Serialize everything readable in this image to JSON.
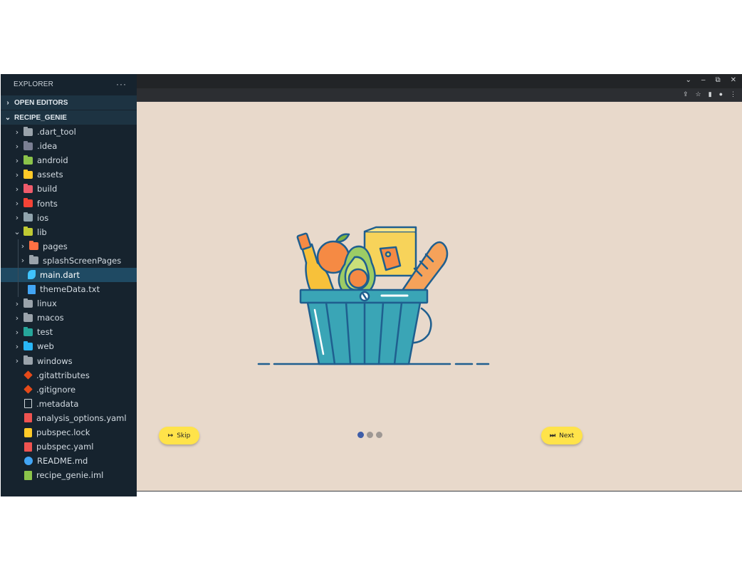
{
  "explorer": {
    "title": "EXPLORER",
    "more": "···",
    "sections": {
      "open_editors": "OPEN EDITORS",
      "project": "RECIPE_GENIE"
    },
    "items": [
      {
        "label": ".dart_tool",
        "color": "#9aa3ab"
      },
      {
        "label": ".idea",
        "color": "#7a7f93"
      },
      {
        "label": "android",
        "color": "#8bc34a"
      },
      {
        "label": "assets",
        "color": "#ffca28"
      },
      {
        "label": "build",
        "color": "#ef5b6b"
      },
      {
        "label": "fonts",
        "color": "#f44336"
      },
      {
        "label": "ios",
        "color": "#90a4ae"
      },
      {
        "label": "lib",
        "color": "#c0ca33"
      },
      {
        "label": "pages",
        "color": "#ff7043"
      },
      {
        "label": "splashScreenPages",
        "color": "#9aa3ab"
      },
      {
        "label": "main.dart",
        "color": "#40c4ff"
      },
      {
        "label": "themeData.txt",
        "color": "#42a5f5"
      },
      {
        "label": "linux",
        "color": "#9aa3ab"
      },
      {
        "label": "macos",
        "color": "#9aa3ab"
      },
      {
        "label": "test",
        "color": "#26a69a"
      },
      {
        "label": "web",
        "color": "#29b6f6"
      },
      {
        "label": "windows",
        "color": "#9aa3ab"
      },
      {
        "label": ".gitattributes",
        "color": "#e64a19"
      },
      {
        "label": ".gitignore",
        "color": "#e64a19"
      },
      {
        "label": ".metadata",
        "color": "#cfd8dc"
      },
      {
        "label": "analysis_options.yaml",
        "color": "#ef5350"
      },
      {
        "label": "pubspec.lock",
        "color": "#ffca28"
      },
      {
        "label": "pubspec.yaml",
        "color": "#ef5350"
      },
      {
        "label": "README.md",
        "color": "#42a5f5"
      },
      {
        "label": "recipe_genie.iml",
        "color": "#8bc34a"
      }
    ]
  },
  "window": {
    "minimize": "–",
    "restore": "⧉",
    "close": "✕",
    "dropdown": "⌄"
  },
  "toolbar": {
    "share": "⇪",
    "bookmark": "☆",
    "sidepanel": "▮",
    "profile": "●",
    "menu": "⋮"
  },
  "onboarding": {
    "skip_icon": "↦",
    "skip_label": "Skip",
    "next_icon": "⏭",
    "next_label": "Next",
    "page_count": 3,
    "active_page": 1,
    "colors": {
      "background": "#e8d9cb",
      "button": "#ffe34a",
      "dot_active": "#3f5ea8",
      "dot_inactive": "#9e9894",
      "basket": "#3aa5b6",
      "outline": "#1f5f8f"
    }
  }
}
